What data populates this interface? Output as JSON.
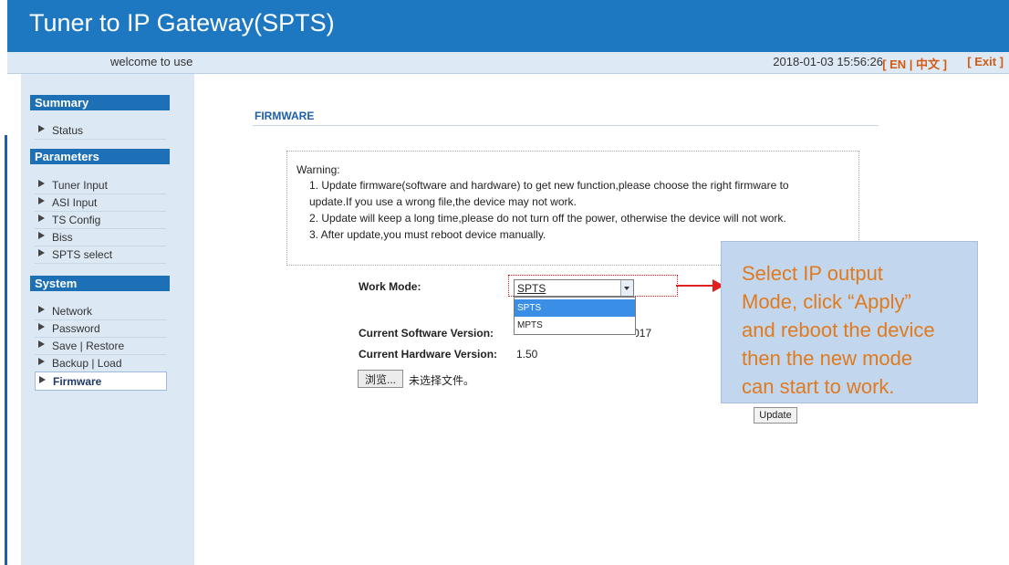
{
  "header": {
    "title": "Tuner to IP Gateway(SPTS)"
  },
  "subbar": {
    "welcome": "welcome to use",
    "datetime": "2018-01-03 15:56:26",
    "lang": "[ EN | 中文 ]",
    "exit": "[ Exit ]"
  },
  "sidebar": {
    "summary": {
      "title": "Summary",
      "items": [
        "Status"
      ]
    },
    "parameters": {
      "title": "Parameters",
      "items": [
        "Tuner Input",
        "ASI Input",
        "TS Config",
        "Biss",
        "SPTS select"
      ]
    },
    "system": {
      "title": "System",
      "items": [
        "Network",
        "Password",
        "Save | Restore",
        "Backup | Load",
        "Firmware"
      ],
      "selected": "Firmware"
    }
  },
  "main": {
    "title": "FIRMWARE",
    "warning": {
      "heading": "Warning:",
      "lines": [
        "1. Update firmware(software and hardware) to get new function,please choose the right firmware to",
        "update.If you use a wrong file,the device may not work.",
        "2. Update will keep a long time,please do not turn off the power, otherwise the device will not work.",
        "3. After update,you must reboot device manually."
      ]
    },
    "work_mode": {
      "label": "Work Mode:",
      "value": "SPTS",
      "options": [
        "SPTS",
        "MPTS"
      ],
      "highlighted": "SPTS"
    },
    "software_version": {
      "label": "Current Software Version:",
      "value": "1.00 Build 100 Nov 13 2017"
    },
    "hardware_version": {
      "label": "Current Hardware Version:",
      "value": "1.50"
    },
    "browse_label": "浏览...",
    "no_file": "未选择文件。",
    "update_label": "Update"
  },
  "callout": {
    "lines": [
      "Select IP output",
      "Mode, click “Apply”",
      "and reboot the device",
      "then the new mode",
      "can start to work."
    ]
  },
  "colors": {
    "header_bg": "#1d78c1",
    "section_bg": "#1d6fb6",
    "accent_orange": "#d35a12",
    "callout_bg": "#c2d7ee",
    "callout_text": "#e07a1f",
    "arrow_red": "#e02020"
  }
}
